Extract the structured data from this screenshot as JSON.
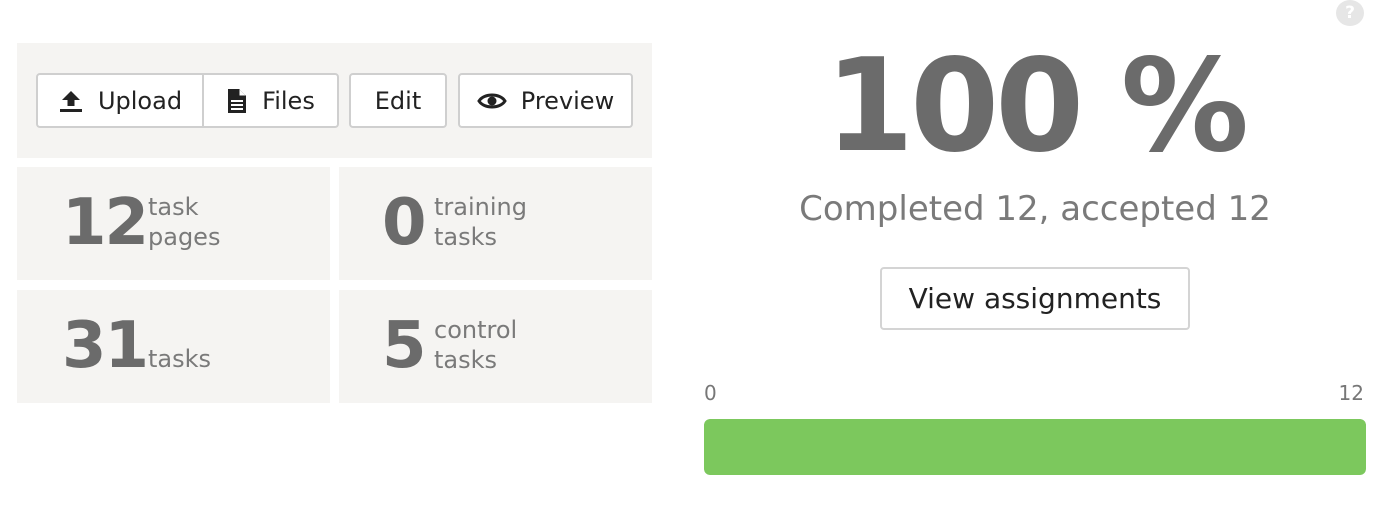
{
  "help": {
    "icon": "question-icon",
    "glyph": "?"
  },
  "toolbar": {
    "upload_label": "Upload",
    "upload_icon": "upload-icon",
    "files_label": "Files",
    "files_icon": "file-icon",
    "edit_label": "Edit",
    "preview_label": "Preview",
    "preview_icon": "eye-icon"
  },
  "stats": [
    {
      "number": "12",
      "label_line1": "task",
      "label_line2": "pages"
    },
    {
      "number": "0",
      "label_line1": "training",
      "label_line2": "tasks"
    },
    {
      "number": "31",
      "label_line1": "tasks",
      "label_line2": ""
    },
    {
      "number": "5",
      "label_line1": "control",
      "label_line2": "tasks"
    }
  ],
  "progress": {
    "percent_text": "100 %",
    "summary_text": "Completed 12, accepted 12",
    "view_button_label": "View assignments",
    "axis_min": "0",
    "axis_max": "12",
    "fraction": 1.0,
    "fill_color": "#7cc85d"
  }
}
